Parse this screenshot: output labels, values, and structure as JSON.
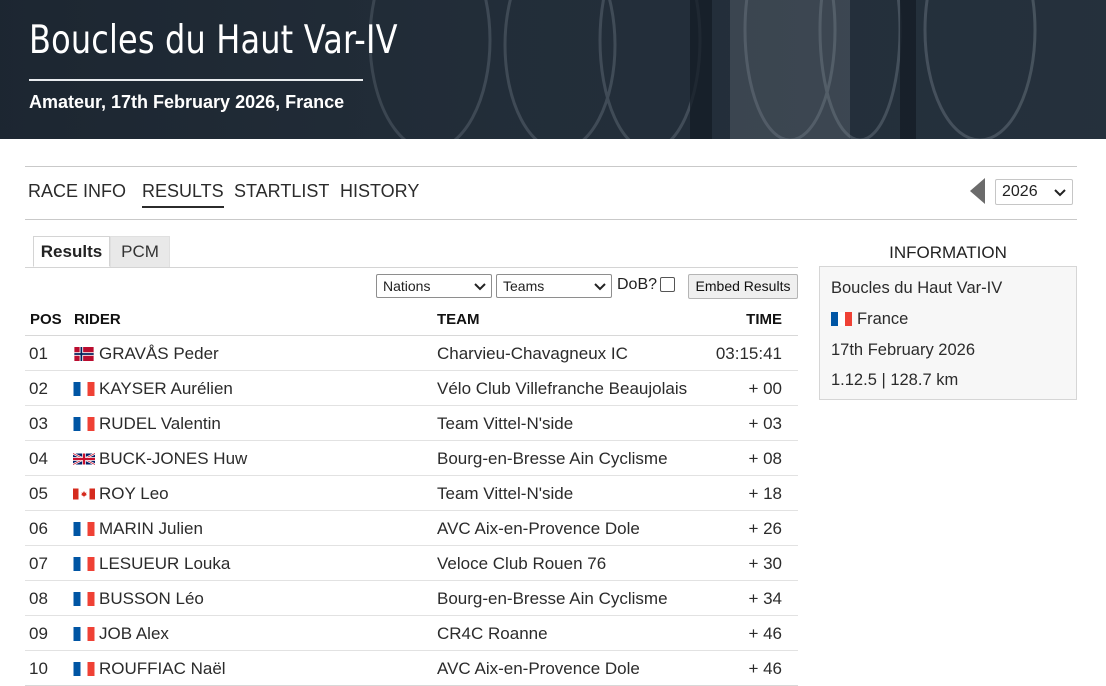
{
  "header": {
    "title": "Boucles du Haut Var-IV",
    "subtitle": "Amateur, 17th February 2026, France"
  },
  "nav": {
    "items": [
      {
        "label": "RACE INFO"
      },
      {
        "label": "RESULTS"
      },
      {
        "label": "STARTLIST"
      },
      {
        "label": "HISTORY"
      }
    ],
    "active": "RESULTS",
    "year": "2026"
  },
  "tabs": {
    "results": "Results",
    "pcm": "PCM"
  },
  "filters": {
    "nations": "Nations",
    "teams": "Teams",
    "dob_label": "DoB?",
    "embed": "Embed Results"
  },
  "table": {
    "headers": {
      "pos": "POS",
      "rider": "RIDER",
      "team": "TEAM",
      "time": "TIME"
    },
    "rows": [
      {
        "pos": "01",
        "flag": "norway-flag",
        "rider": "GRAVÅS Peder",
        "team": "Charvieu-Chavagneux IC",
        "time": "03:15:41"
      },
      {
        "pos": "02",
        "flag": "france-flag",
        "rider": "KAYSER Aurélien",
        "team": "Vélo Club Villefranche Beaujolais",
        "time": "+ 00"
      },
      {
        "pos": "03",
        "flag": "france-flag",
        "rider": "RUDEL Valentin",
        "team": "Team Vittel-N'side",
        "time": "+ 03"
      },
      {
        "pos": "04",
        "flag": "uk-flag",
        "rider": "BUCK-JONES Huw",
        "team": "Bourg-en-Bresse Ain Cyclisme",
        "time": "+ 08"
      },
      {
        "pos": "05",
        "flag": "canada-flag",
        "rider": "ROY Leo",
        "team": "Team Vittel-N'side",
        "time": "+ 18"
      },
      {
        "pos": "06",
        "flag": "france-flag",
        "rider": "MARIN Julien",
        "team": "AVC Aix-en-Provence Dole",
        "time": "+ 26"
      },
      {
        "pos": "07",
        "flag": "france-flag",
        "rider": "LESUEUR Louka",
        "team": "Veloce Club Rouen 76",
        "time": "+ 30"
      },
      {
        "pos": "08",
        "flag": "france-flag",
        "rider": "BUSSON Léo",
        "team": "Bourg-en-Bresse Ain Cyclisme",
        "time": "+ 34"
      },
      {
        "pos": "09",
        "flag": "france-flag",
        "rider": "JOB Alex",
        "team": "CR4C Roanne",
        "time": "+ 46"
      },
      {
        "pos": "10",
        "flag": "france-flag",
        "rider": "ROUFFIAC Naël",
        "team": "AVC Aix-en-Provence Dole",
        "time": "+ 46"
      }
    ]
  },
  "info": {
    "title": "INFORMATION",
    "race": "Boucles du Haut Var-IV",
    "country": "France",
    "date": "17th February 2026",
    "details": "1.12.5 | 128.7 km"
  }
}
